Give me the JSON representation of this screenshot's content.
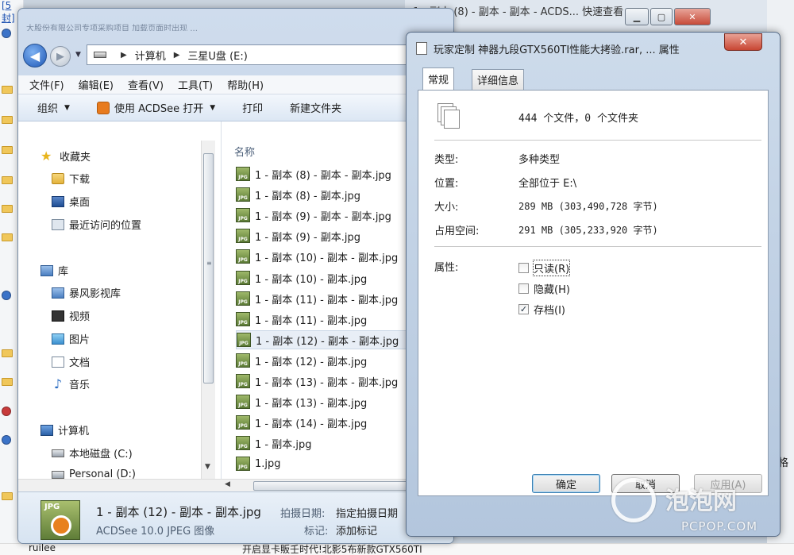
{
  "background": {
    "top_link": "[5封]",
    "top_title": "1 - 副本 (8) - 副本 - 副本 - ACDS... 快速查看",
    "right_char": "格",
    "bottom_left": "ruilee",
    "bottom_text": "开启显卡販壬时代!北影5布新款GTX560TI"
  },
  "explorer": {
    "title_faded": "大股份有限公司专项采购项目    加载页面时出现   ...",
    "back_glyph": "◀",
    "fwd_glyph": "▶",
    "address": [
      "计算机",
      "三星U盘 (E:)"
    ],
    "menu": [
      "文件(F)",
      "编辑(E)",
      "查看(V)",
      "工具(T)",
      "帮助(H)"
    ],
    "toolbar": {
      "organize": "组织",
      "open_with": "使用 ACDSee 打开",
      "print": "打印",
      "new_folder": "新建文件夹"
    },
    "nav": {
      "favorites": "收藏夹",
      "downloads": "下载",
      "desktop": "桌面",
      "recent": "最近访问的位置",
      "libraries": "库",
      "storm_video": "暴风影视库",
      "videos": "视频",
      "pictures": "图片",
      "documents": "文档",
      "music": "音乐",
      "computer": "计算机",
      "local_disk": "本地磁盘 (C:)",
      "personal": "Personal (D:)"
    },
    "column_name": "名称",
    "files": [
      "1 - 副本 (8) - 副本 - 副本.jpg",
      "1 - 副本 (8) - 副本.jpg",
      "1 - 副本 (9) - 副本 - 副本.jpg",
      "1 - 副本 (9) - 副本.jpg",
      "1 - 副本 (10) - 副本 - 副本.jpg",
      "1 - 副本 (10) - 副本.jpg",
      "1 - 副本 (11) - 副本 - 副本.jpg",
      "1 - 副本 (11) - 副本.jpg",
      "1 - 副本 (12) - 副本 - 副本.jpg",
      "1 - 副本 (12) - 副本.jpg",
      "1 - 副本 (13) - 副本 - 副本.jpg",
      "1 - 副本 (13) - 副本.jpg",
      "1 - 副本 (14) - 副本.jpg",
      "1 - 副本.jpg",
      "1.jpg"
    ],
    "selected_index": 8,
    "icon_label": "JPG",
    "details": {
      "name": "1 - 副本 (12) - 副本 - 副本.jpg",
      "type": "ACDSee 10.0 JPEG 图像",
      "date_label": "拍摄日期:",
      "date_value": "指定拍摄日期",
      "tag_label": "标记:",
      "tag_value": "添加标记"
    }
  },
  "props": {
    "title": "玩家定制 神器九段GTX560TI性能大拷验.rar, ... 属性",
    "close_glyph": "✕",
    "tabs": [
      "常规",
      "详细信息"
    ],
    "count": "444 个文件，0 个文件夹",
    "type_label": "类型:",
    "type_value": "多种类型",
    "location_label": "位置:",
    "location_value": "全部位于 E:\\",
    "size_label": "大小:",
    "size_value": "289 MB (303,490,728 字节)",
    "disk_label": "占用空间:",
    "disk_value": "291 MB (305,233,920 字节)",
    "attr_label": "属性:",
    "attrs": [
      {
        "label": "只读(R)",
        "checked": false
      },
      {
        "label": "隐藏(H)",
        "checked": false
      },
      {
        "label": "存档(I)",
        "checked": true
      }
    ],
    "check_mark": "✓",
    "ok": "确定",
    "cancel": "取消",
    "apply": "应用(A)"
  },
  "watermark": {
    "logo": "泡泡网",
    "url": "PCPOP.COM"
  }
}
